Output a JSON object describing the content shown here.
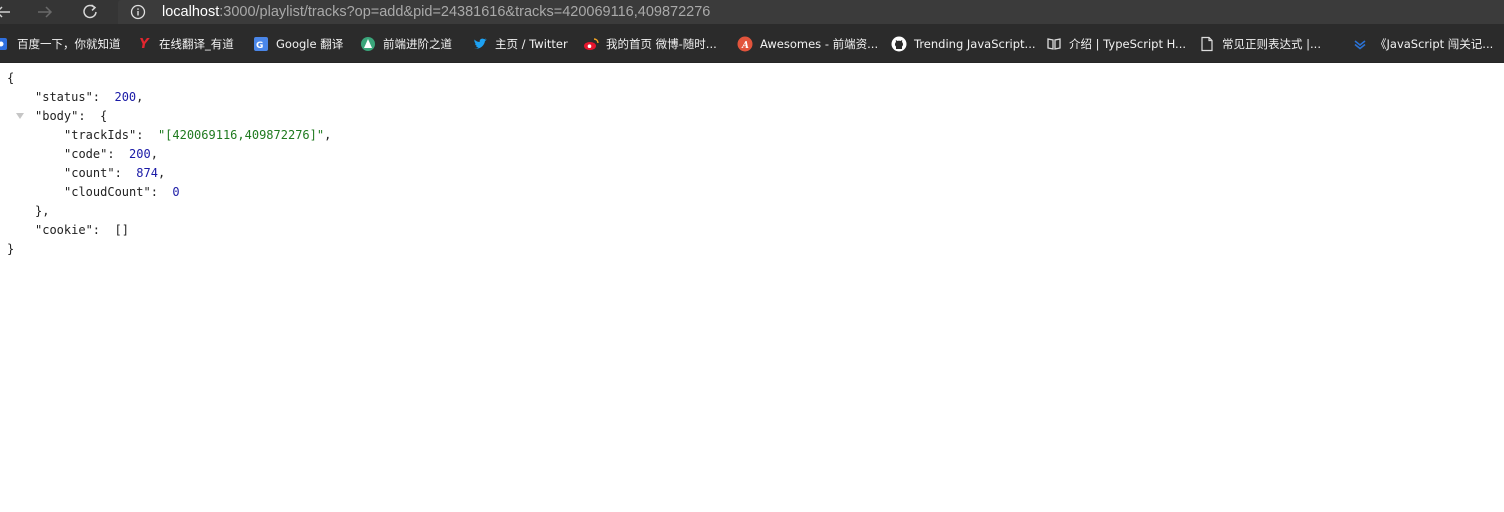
{
  "address_bar": {
    "url_host": "localhost",
    "url_rest": ":3000/playlist/tracks?op=add&pid=24381616&tracks=420069116,409872276"
  },
  "bookmarks": [
    {
      "label": "百度一下，你就知道",
      "icon": "baidu-icon",
      "color": "#2f6fde"
    },
    {
      "label": "在线翻译_有道",
      "icon": "youdao-icon",
      "color": "#e3262f"
    },
    {
      "label": "Google 翻译",
      "icon": "google-translate-icon",
      "color": "#4a86e8"
    },
    {
      "label": "前端进阶之道",
      "icon": "frontend-icon",
      "color": "#3aa57a"
    },
    {
      "label": "主页 / Twitter",
      "icon": "twitter-icon",
      "color": "#1da1f2"
    },
    {
      "label": "我的首页 微博-随时...",
      "icon": "weibo-icon",
      "color": "#e6162d"
    },
    {
      "label": "Awesomes - 前端资...",
      "icon": "awesomes-icon",
      "color": "#e2543c"
    },
    {
      "label": "Trending JavaScript...",
      "icon": "github-icon",
      "color": "#ffffff"
    },
    {
      "label": "介绍 | TypeScript H...",
      "icon": "typescript-book-icon",
      "color": "#dddddd"
    },
    {
      "label": "常见正则表达式 |...",
      "icon": "page-icon",
      "color": "#dddddd"
    },
    {
      "label": "《JavaScript 闯关记...",
      "icon": "layers-icon",
      "color": "#2a72d6"
    }
  ],
  "json_view": {
    "open_brace": "{",
    "status_key": "\"status\":",
    "status_value": "200",
    "body_key": "\"body\":",
    "body_open": "{",
    "trackIds_key": "\"trackIds\":",
    "trackIds_value": "\"[420069116,409872276]\"",
    "code_key": "\"code\":",
    "code_value": "200",
    "count_key": "\"count\":",
    "count_value": "874",
    "cloudCount_key": "\"cloudCount\":",
    "cloudCount_value": "0",
    "body_close": "},",
    "cookie_key": "\"cookie\":",
    "cookie_value": "[]",
    "close_brace": "}",
    "comma": ","
  }
}
